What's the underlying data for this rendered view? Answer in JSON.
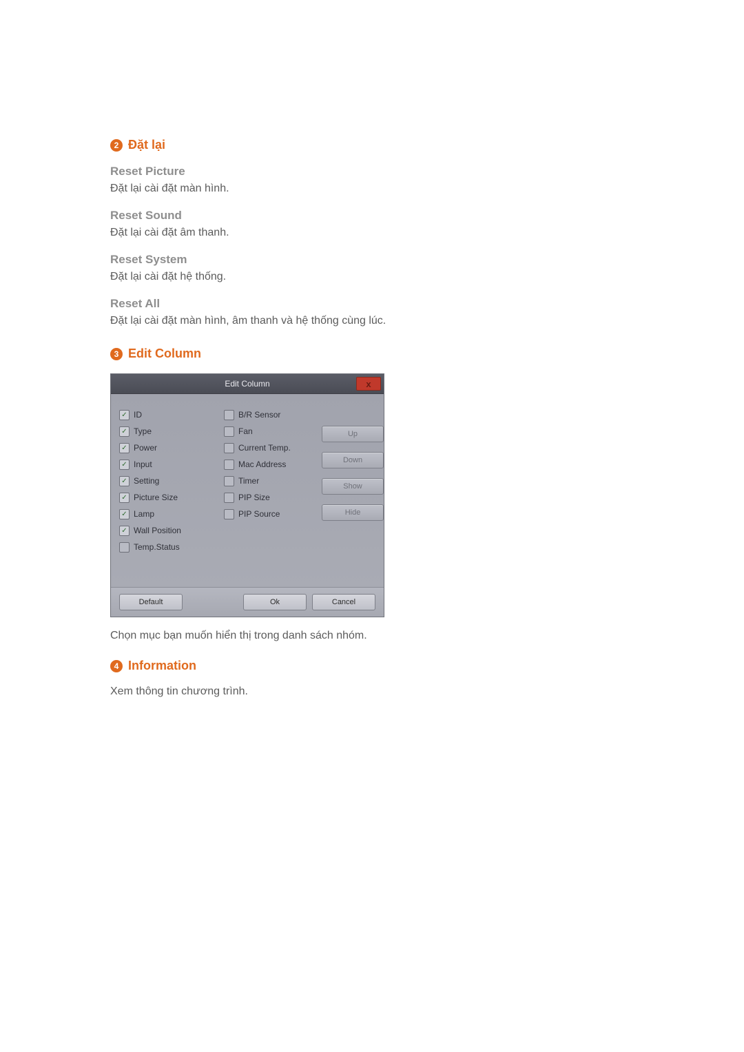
{
  "section2": {
    "num": "2",
    "title": "Đặt lại",
    "items": [
      {
        "head": "Reset Picture",
        "body": "Đặt lại cài đặt màn hình."
      },
      {
        "head": "Reset Sound",
        "body": "Đặt lại cài đặt âm thanh."
      },
      {
        "head": "Reset System",
        "body": "Đặt lại cài đặt hệ thống."
      },
      {
        "head": "Reset All",
        "body": "Đặt lại cài đặt màn hình, âm thanh và hệ thống cùng lúc."
      }
    ]
  },
  "section3": {
    "num": "3",
    "title": "Edit Column",
    "dialog": {
      "title": "Edit Column",
      "close_glyph": "x",
      "left_col": [
        {
          "label": "ID",
          "checked": true
        },
        {
          "label": "Type",
          "checked": true
        },
        {
          "label": "Power",
          "checked": true
        },
        {
          "label": "Input",
          "checked": true
        },
        {
          "label": "Setting",
          "checked": true
        },
        {
          "label": "Picture Size",
          "checked": true
        },
        {
          "label": "Lamp",
          "checked": true
        },
        {
          "label": "Wall Position",
          "checked": true
        },
        {
          "label": "Temp.Status",
          "checked": false
        }
      ],
      "mid_col": [
        {
          "label": "B/R Sensor",
          "checked": false
        },
        {
          "label": "Fan",
          "checked": false
        },
        {
          "label": "Current Temp.",
          "checked": false
        },
        {
          "label": "Mac Address",
          "checked": false
        },
        {
          "label": "Timer",
          "checked": false
        },
        {
          "label": "PIP Size",
          "checked": false
        },
        {
          "label": "PIP Source",
          "checked": false
        }
      ],
      "side_buttons": [
        {
          "label": "Up",
          "enabled": false
        },
        {
          "label": "Down",
          "enabled": false
        },
        {
          "label": "Show",
          "enabled": false
        },
        {
          "label": "Hide",
          "enabled": false
        }
      ],
      "footer": {
        "default": "Default",
        "ok": "Ok",
        "cancel": "Cancel"
      }
    },
    "caption": "Chọn mục bạn muốn hiển thị trong danh sách nhóm."
  },
  "section4": {
    "num": "4",
    "title": "Information",
    "body": "Xem thông tin chương trình."
  }
}
